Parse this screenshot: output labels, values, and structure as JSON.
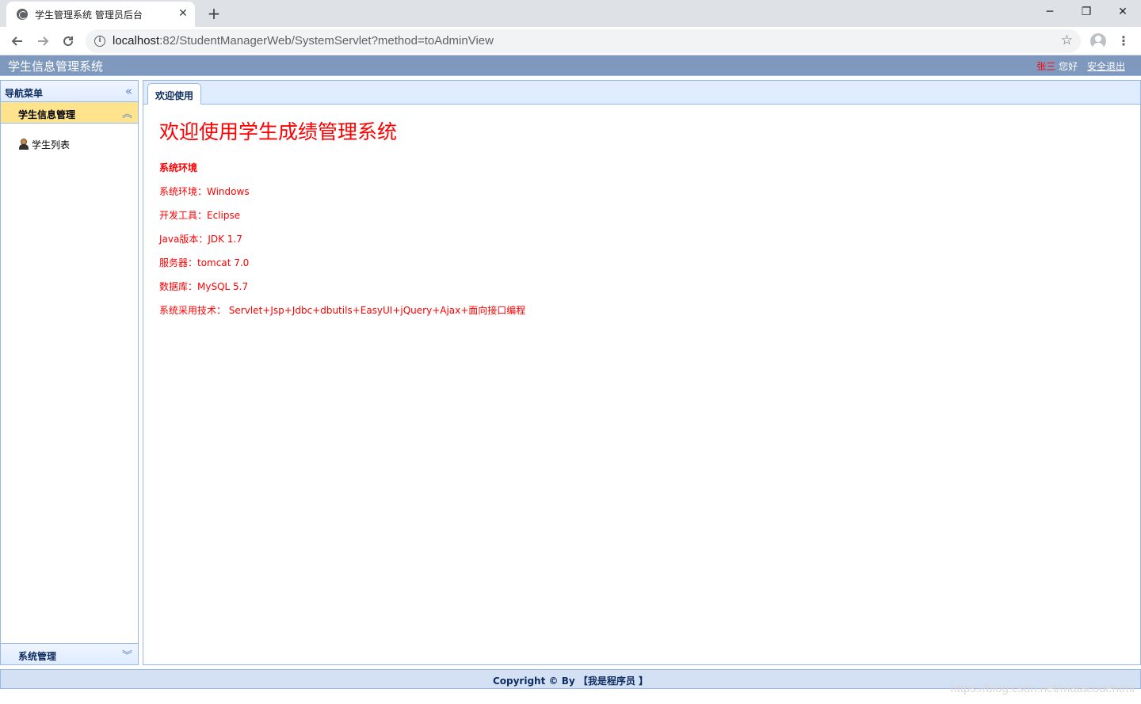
{
  "browser": {
    "tab_title": "学生管理系统 管理员后台",
    "close_glyph": "✕",
    "newtab_glyph": "+",
    "url_host": "localhost",
    "url_rest": ":82/StudentManagerWeb/SystemServlet?method=toAdminView",
    "window_controls": {
      "minimize": "─",
      "restore": "❐",
      "close": "✕"
    },
    "icons": [
      "globe-icon",
      "back-arrow-icon",
      "forward-arrow-icon",
      "reload-icon",
      "info-icon",
      "star-icon",
      "profile-icon",
      "menu-dots-icon"
    ]
  },
  "header": {
    "app_title": "学生信息管理系统",
    "user_name": "张三",
    "greeting": "您好",
    "logout_label": "安全退出"
  },
  "sidebar": {
    "title": "导航菜单",
    "active_section": "学生信息管理",
    "items": [
      {
        "label": "学生列表",
        "icon": "user-icon"
      }
    ],
    "bottom_section": "系统管理"
  },
  "main": {
    "tabs": [
      {
        "label": "欢迎使用"
      }
    ],
    "welcome_heading": "欢迎使用学生成绩管理系统",
    "env_title": "系统环境",
    "env_lines": [
      "系统环境：Windows",
      "开发工具：Eclipse",
      "Java版本：JDK 1.7",
      "服务器：tomcat 7.0",
      "数据库：MySQL 5.7",
      "系统采用技术： Servlet+Jsp+Jdbc+dbutils+EasyUI+jQuery+Ajax+面向接口编程"
    ]
  },
  "footer": {
    "copyright": "Copyright © By 【我是程序员 】"
  },
  "watermark": "https://blog.csdn.net/matacodehtml",
  "colors": {
    "header_bg": "#7f99be",
    "border": "#95b8e7",
    "active_accordion": "#ffe48d",
    "accent_red": "#ff0000",
    "footer_bg": "#d4e1f4"
  }
}
